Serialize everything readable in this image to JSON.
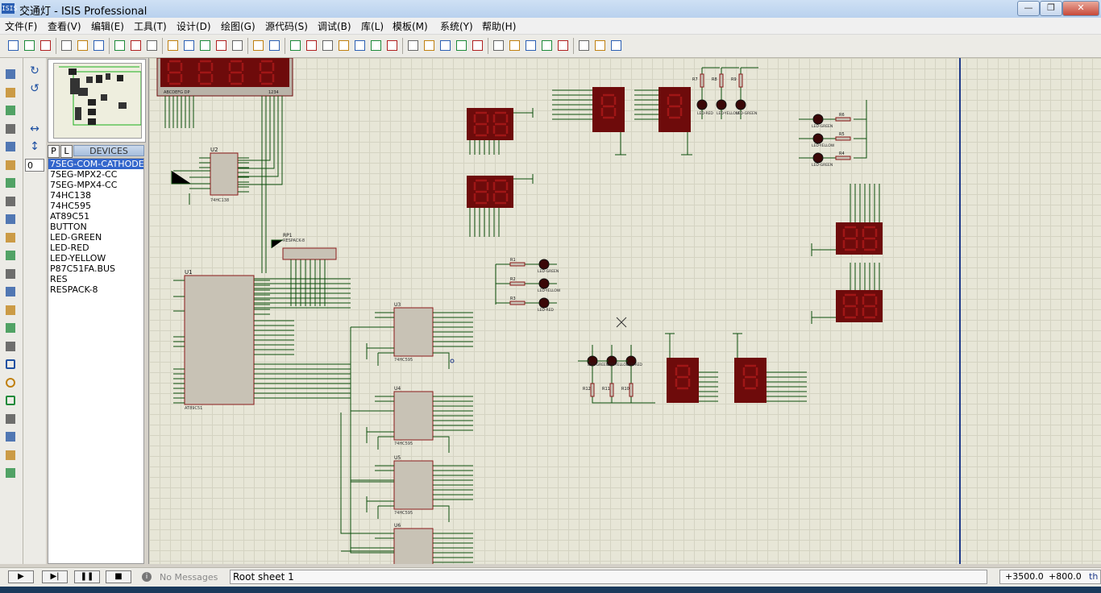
{
  "window": {
    "icon_text": "ISIS",
    "title": "交通灯 - ISIS Professional",
    "buttons": [
      "—",
      "❐",
      "✕"
    ]
  },
  "menu": [
    "文件(F)",
    "查看(V)",
    "编辑(E)",
    "工具(T)",
    "设计(D)",
    "绘图(G)",
    "源代码(S)",
    "调试(B)",
    "库(L)",
    "模板(M)",
    "系统(Y)",
    "帮助(H)"
  ],
  "toolbar": {
    "icons": [
      "new-icon",
      "open-icon",
      "save-icon",
      "import-icon",
      "print-icon",
      "print-area-icon",
      "refresh-icon",
      "grid-icon",
      "origin-icon",
      "pan-icon",
      "zoom-in-icon",
      "zoom-out-icon",
      "zoom-all-icon",
      "zoom-area-icon",
      "undo-icon",
      "redo-icon",
      "cut-icon",
      "copy-icon",
      "paste-icon",
      "block-copy-icon",
      "block-move-icon",
      "block-rotate-icon",
      "block-delete-icon",
      "pick-device-icon",
      "make-device-icon",
      "packaging-icon",
      "decompose-icon",
      "wire-autorouter-icon",
      "search-tag-icon",
      "property-assign-icon",
      "new-sheet-icon",
      "remove-sheet-icon",
      "exit-to-parent-icon",
      "bill-of-materials-icon",
      "electrical-check-icon",
      "netlist-icon"
    ]
  },
  "leftbar": {
    "tools": [
      "selection-mode-icon",
      "component-mode-icon",
      "junction-dot-icon",
      "wire-label-icon",
      "text-script-icon",
      "buses-icon",
      "subcircuit-icon",
      "terminals-icon",
      "device-pins-icon",
      "graph-icon",
      "tape-recorder-icon",
      "generator-icon",
      "voltage-probe-icon",
      "current-probe-icon",
      "virtual-instruments-icon",
      "line-icon",
      "box-icon",
      "circle-icon",
      "arc-icon",
      "path-icon",
      "text-icon",
      "symbol-icon",
      "marker-icon"
    ]
  },
  "rotate": {
    "zoom_value": "0"
  },
  "devices": {
    "header": "DEVICES",
    "p_label": "P",
    "l_label": "L",
    "items": [
      "7SEG-COM-CATHODE",
      "7SEG-MPX2-CC",
      "7SEG-MPX4-CC",
      "74HC138",
      "74HC595",
      "AT89C51",
      "BUTTON",
      "LED-GREEN",
      "LED-RED",
      "LED-YELLOW",
      "P87C51FA.BUS",
      "RES",
      "RESPACK-8"
    ],
    "selected_index": 0
  },
  "schematic": {
    "u1": "U1",
    "u1_part": "AT89C51",
    "u2": "U2",
    "u2_part": "74HC138",
    "rp1": "RP1",
    "rp1_part": "RESPACK-8",
    "u3": "U3",
    "u4": "U4",
    "u5": "U5",
    "u6": "U6",
    "shift_part": "74HC595",
    "led_green": "LED-GREEN",
    "led_yellow": "LED-YELLOW",
    "led_red": "LED-RED",
    "resistors": [
      "R1",
      "R2",
      "R3",
      "R4",
      "R5",
      "R6",
      "R7",
      "R8",
      "R9",
      "R10",
      "R11",
      "R12"
    ],
    "res_value": "220",
    "leds": [
      "D1",
      "D2",
      "D3",
      "D4",
      "D5",
      "D6",
      "D7",
      "D8",
      "D9",
      "D10",
      "D11",
      "D12"
    ],
    "seg_labels": "ABCDEFG DP",
    "digit_labels": "1234"
  },
  "status": {
    "play_buttons": [
      "▶",
      "▶|",
      "❚❚",
      "■"
    ],
    "messages": "No Messages",
    "sheet": "Root sheet 1",
    "coord_x": "+3500.0",
    "coord_y": "+800.0",
    "units": "th"
  },
  "colors": {
    "canvas_bg": "#e7e6d7",
    "component_body": "#6e0b0b",
    "seg_lit": "#a01616",
    "wire": "#0b4d0b",
    "chip_fill": "#c8c2b5",
    "chip_outline": "#8a1a1a",
    "sheet_border": "#1f3a8a"
  }
}
